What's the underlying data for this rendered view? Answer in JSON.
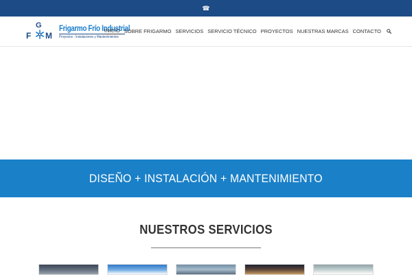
{
  "topbar": {
    "icon": "phone-icon",
    "icon_glyph": "☎",
    "background": "#1c4b86"
  },
  "logo": {
    "mark_letters": [
      "G",
      "F",
      "M"
    ],
    "name": "Frigarmo Frío Industrial",
    "tagline": "Proyectos - Instalaciones y Mantenimientos",
    "color": "#1c7ecb"
  },
  "nav": {
    "items": [
      {
        "label": "INICIO",
        "active": true
      },
      {
        "label": "SOBRE FRIGARMO",
        "active": false
      },
      {
        "label": "SERVICIOS",
        "active": false
      },
      {
        "label": "SERVICIO TÉCNICO",
        "active": false
      },
      {
        "label": "PROYECTOS",
        "active": false
      },
      {
        "label": "NUESTRAS MARCAS",
        "active": false
      },
      {
        "label": "CONTACTO",
        "active": false
      }
    ],
    "search_icon": "search-icon"
  },
  "banner": {
    "text": "DISEÑO + INSTALACIÓN + MANTENIMIENTO",
    "background": "#1a80c8"
  },
  "services": {
    "title": "NUESTROS SERVICIOS",
    "thumbnails": [
      "service-image-1",
      "service-image-2",
      "service-image-3",
      "service-image-4",
      "service-image-5"
    ]
  }
}
